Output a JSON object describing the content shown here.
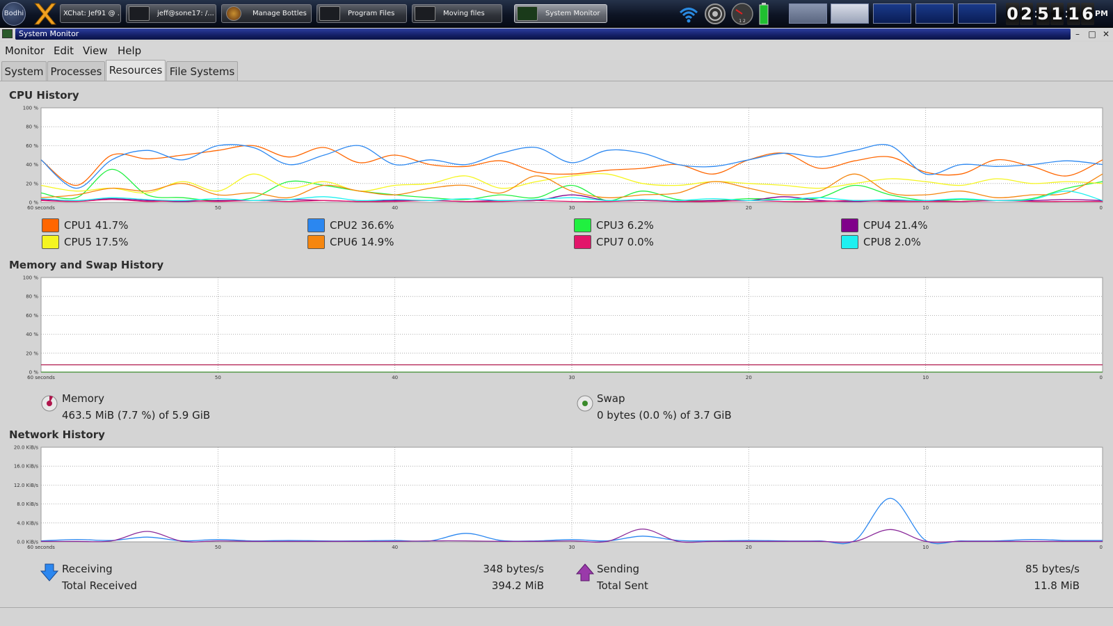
{
  "taskbar": {
    "start_label": "Bodhi",
    "tasks": [
      {
        "label": "XChat: Jef91 @ ...",
        "active": false
      },
      {
        "label": "jeff@sone17: /...",
        "active": false
      },
      {
        "label": "Manage Bottles",
        "active": false
      },
      {
        "label": "Program Files",
        "active": false
      },
      {
        "label": "Moving files",
        "active": false
      },
      {
        "label": "System Monitor",
        "active": true
      }
    ],
    "tray_icons": [
      "wifi-icon",
      "speaker-icon",
      "cpu-gauge-icon",
      "battery-icon"
    ],
    "gauge_label": "1 2",
    "clock": {
      "h1": "0",
      "h2": "2",
      "m1": "5",
      "m2": "1",
      "s1": "1",
      "s2": "6",
      "ampm": "PM"
    }
  },
  "window": {
    "title": "System Monitor",
    "controls": {
      "minimize": "–",
      "maximize": "□",
      "close": "✕"
    }
  },
  "menu": [
    {
      "label": "Monitor"
    },
    {
      "label": "Edit"
    },
    {
      "label": "View"
    },
    {
      "label": "Help"
    }
  ],
  "tabs": [
    {
      "label": "System",
      "active": false
    },
    {
      "label": "Processes",
      "active": false
    },
    {
      "label": "Resources",
      "active": true
    },
    {
      "label": "File Systems",
      "active": false
    }
  ],
  "cpu": {
    "title": "CPU History",
    "legend": [
      {
        "label": "CPU1 41.7%",
        "color": "#ff6600"
      },
      {
        "label": "CPU2 36.6%",
        "color": "#2b87f0"
      },
      {
        "label": "CPU3 6.2%",
        "color": "#20f040"
      },
      {
        "label": "CPU4 21.4%",
        "color": "#80008a"
      },
      {
        "label": "CPU5 17.5%",
        "color": "#f5f520"
      },
      {
        "label": "CPU6 14.9%",
        "color": "#f5860f"
      },
      {
        "label": "CPU7 0.0%",
        "color": "#e2156a"
      },
      {
        "label": "CPU8 2.0%",
        "color": "#1ef0f0"
      }
    ]
  },
  "memory": {
    "title": "Memory and Swap History",
    "memory_label": "Memory",
    "memory_value": "463.5 MiB (7.7 %) of 5.9 GiB",
    "memory_color": "#b0164c",
    "swap_label": "Swap",
    "swap_value": "0 bytes (0.0 %) of 3.7 GiB",
    "swap_color": "#3a8a2a"
  },
  "network": {
    "title": "Network History",
    "receiving_label": "Receiving",
    "receiving_rate": "348 bytes/s",
    "total_received_label": "Total Received",
    "total_received": "394.2 MiB",
    "receiving_color": "#2b87f0",
    "sending_label": "Sending",
    "sending_rate": "85 bytes/s",
    "total_sent_label": "Total Sent",
    "total_sent": "11.8 MiB",
    "sending_color": "#8a2a9a"
  },
  "chart_data": [
    {
      "type": "line",
      "title": "CPU History",
      "x": [
        60,
        58,
        56,
        54,
        52,
        50,
        48,
        46,
        44,
        42,
        40,
        38,
        36,
        34,
        32,
        30,
        28,
        26,
        24,
        22,
        20,
        18,
        16,
        14,
        12,
        10,
        8,
        6,
        4,
        2,
        0
      ],
      "x_ticks": [
        "60 seconds",
        "50",
        "40",
        "30",
        "20",
        "10",
        "0"
      ],
      "y_ticks": [
        "100 %",
        "80 %",
        "60 %",
        "40 %",
        "20 %",
        "0 %"
      ],
      "ylim": [
        0,
        100
      ],
      "grid": true,
      "series": [
        {
          "name": "CPU1 41.7%",
          "color": "#ff6600",
          "values": [
            45,
            18,
            50,
            46,
            50,
            55,
            60,
            48,
            58,
            42,
            50,
            40,
            38,
            44,
            32,
            30,
            34,
            36,
            40,
            30,
            45,
            52,
            36,
            44,
            48,
            32,
            30,
            45,
            38,
            28,
            45
          ]
        },
        {
          "name": "CPU2 36.6%",
          "color": "#2b87f0",
          "values": [
            45,
            15,
            45,
            55,
            45,
            60,
            58,
            40,
            50,
            60,
            40,
            45,
            40,
            52,
            58,
            42,
            55,
            52,
            40,
            38,
            45,
            52,
            48,
            55,
            60,
            30,
            40,
            38,
            40,
            44,
            40
          ]
        },
        {
          "name": "CPU3 6.2%",
          "color": "#20f040",
          "values": [
            10,
            5,
            35,
            8,
            5,
            2,
            5,
            22,
            18,
            12,
            8,
            5,
            3,
            8,
            5,
            18,
            2,
            12,
            3,
            2,
            4,
            3,
            5,
            18,
            8,
            2,
            3,
            2,
            4,
            15,
            22
          ]
        },
        {
          "name": "CPU4 21.4%",
          "color": "#80008a",
          "values": [
            3,
            2,
            4,
            2,
            1,
            2,
            2,
            3,
            2,
            1,
            2,
            2,
            1,
            2,
            2,
            8,
            2,
            2,
            1,
            2,
            2,
            6,
            2,
            1,
            2,
            2,
            1,
            2,
            2,
            3,
            2
          ]
        },
        {
          "name": "CPU5 17.5%",
          "color": "#f5f520",
          "values": [
            18,
            12,
            15,
            10,
            22,
            12,
            30,
            15,
            22,
            12,
            18,
            20,
            28,
            15,
            22,
            28,
            30,
            20,
            18,
            22,
            20,
            18,
            15,
            20,
            25,
            22,
            18,
            25,
            20,
            22,
            20
          ]
        },
        {
          "name": "CPU6 14.9%",
          "color": "#f5860f",
          "values": [
            5,
            8,
            15,
            12,
            20,
            8,
            10,
            5,
            18,
            12,
            8,
            15,
            18,
            10,
            28,
            12,
            5,
            8,
            10,
            22,
            15,
            8,
            12,
            30,
            10,
            8,
            12,
            5,
            8,
            10,
            30
          ]
        },
        {
          "name": "CPU7 0.0%",
          "color": "#e2156a",
          "values": [
            2,
            1,
            3,
            1,
            2,
            1,
            2,
            1,
            2,
            1,
            1,
            2,
            1,
            1,
            2,
            1,
            1,
            2,
            1,
            1,
            2,
            1,
            1,
            2,
            1,
            1,
            1,
            2,
            1,
            1,
            1
          ]
        },
        {
          "name": "CPU8 2.0%",
          "color": "#1ef0f0",
          "values": [
            4,
            2,
            5,
            3,
            2,
            4,
            2,
            3,
            6,
            2,
            3,
            2,
            4,
            2,
            3,
            5,
            2,
            3,
            2,
            4,
            2,
            3,
            5,
            2,
            3,
            2,
            4,
            2,
            3,
            12,
            2
          ]
        }
      ]
    },
    {
      "type": "line",
      "title": "Memory and Swap History",
      "x": [
        60,
        0
      ],
      "x_ticks": [
        "60 seconds",
        "50",
        "40",
        "30",
        "20",
        "10",
        "0"
      ],
      "y_ticks": [
        "100 %",
        "80 %",
        "60 %",
        "40 %",
        "20 %",
        "0 %"
      ],
      "ylim": [
        0,
        100
      ],
      "grid": true,
      "series": [
        {
          "name": "Memory",
          "color": "#b0164c",
          "values": [
            7.7,
            7.7
          ]
        },
        {
          "name": "Swap",
          "color": "#3a8a2a",
          "values": [
            0,
            0
          ]
        }
      ]
    },
    {
      "type": "line",
      "title": "Network History",
      "x": [
        60,
        58,
        56,
        54,
        52,
        50,
        48,
        46,
        44,
        42,
        40,
        38,
        36,
        34,
        32,
        30,
        28,
        26,
        24,
        22,
        20,
        18,
        16,
        14,
        12,
        10,
        8,
        6,
        4,
        2,
        0
      ],
      "x_ticks": [
        "60 seconds",
        "50",
        "40",
        "30",
        "20",
        "10",
        "0"
      ],
      "y_ticks": [
        "20.0 KiB/s",
        "16.0 KiB/s",
        "12.0 KiB/s",
        "8.0 KiB/s",
        "4.0 KiB/s",
        "0.0 KiB/s"
      ],
      "ylim": [
        0,
        20
      ],
      "grid": true,
      "series": [
        {
          "name": "Receiving",
          "color": "#2b87f0",
          "values": [
            0.2,
            0.5,
            0.3,
            1.0,
            0.2,
            0.5,
            0.2,
            0.3,
            0.2,
            0.2,
            0.3,
            0.2,
            1.8,
            0.3,
            0.2,
            0.5,
            0.2,
            1.2,
            0.3,
            0.2,
            0.3,
            0.2,
            0.2,
            0.3,
            9.2,
            0.3,
            0.2,
            0.2,
            0.5,
            0.3,
            0.3
          ]
        },
        {
          "name": "Sending",
          "color": "#8a2a9a",
          "values": [
            0.1,
            0.1,
            0.2,
            2.2,
            0.1,
            0.2,
            0.1,
            0.1,
            0.1,
            0.1,
            0.1,
            0.2,
            0.2,
            0.1,
            0.1,
            0.2,
            0.1,
            2.7,
            0.1,
            0.1,
            0.1,
            0.1,
            0.1,
            0.1,
            2.6,
            0.1,
            0.1,
            0.1,
            0.1,
            0.1,
            0.1
          ]
        }
      ]
    }
  ]
}
